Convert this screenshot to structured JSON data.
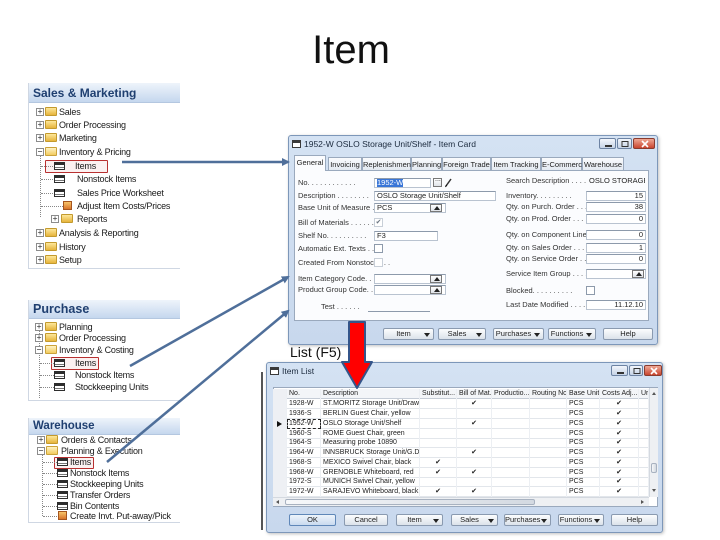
{
  "slide_title": "Item",
  "list_label": "List (F5)",
  "nav_panels": {
    "sales_marketing": {
      "header": "Sales & Marketing",
      "items": [
        {
          "label": "Sales",
          "expander": "+",
          "icon": "folder-icon"
        },
        {
          "label": "Order Processing",
          "expander": "+",
          "icon": "folder-icon"
        },
        {
          "label": "Marketing",
          "expander": "+",
          "icon": "folder-icon"
        },
        {
          "label": "Inventory & Pricing",
          "expander": "−",
          "icon": "folder-open-icon"
        },
        {
          "label": "Items",
          "icon": "list-icon",
          "highlighted": true
        },
        {
          "label": "Nonstock Items",
          "icon": "list-icon"
        },
        {
          "label": "Sales Price Worksheet",
          "icon": "list-icon"
        },
        {
          "label": "Adjust Item Costs/Prices",
          "icon": "task-icon"
        },
        {
          "label": "Reports",
          "expander": "+",
          "icon": "folder-icon"
        },
        {
          "label": "Analysis & Reporting",
          "expander": "+",
          "icon": "folder-icon"
        },
        {
          "label": "History",
          "expander": "+",
          "icon": "folder-icon"
        },
        {
          "label": "Setup",
          "expander": "+",
          "icon": "folder-icon"
        }
      ]
    },
    "purchase": {
      "header": "Purchase",
      "items": [
        {
          "label": "Planning",
          "expander": "+",
          "icon": "folder-icon"
        },
        {
          "label": "Order Processing",
          "expander": "+",
          "icon": "folder-icon"
        },
        {
          "label": "Inventory & Costing",
          "expander": "−",
          "icon": "folder-open-icon"
        },
        {
          "label": "Items",
          "icon": "list-icon",
          "highlighted": true
        },
        {
          "label": "Nonstock Items",
          "icon": "list-icon"
        },
        {
          "label": "Stockkeeping Units",
          "icon": "list-icon"
        }
      ]
    },
    "warehouse": {
      "header": "Warehouse",
      "items": [
        {
          "label": "Orders & Contacts",
          "expander": "+",
          "icon": "folder-icon"
        },
        {
          "label": "Planning & Execution",
          "expander": "−",
          "icon": "folder-open-icon"
        },
        {
          "label": "Items",
          "icon": "list-icon",
          "highlighted": true
        },
        {
          "label": "Nonstock Items",
          "icon": "list-icon"
        },
        {
          "label": "Stockkeeping Units",
          "icon": "list-icon"
        },
        {
          "label": "Transfer Orders",
          "icon": "list-icon"
        },
        {
          "label": "Bin Contents",
          "icon": "list-icon"
        },
        {
          "label": "Create Invt. Put-away/Pick",
          "icon": "task-icon"
        }
      ]
    }
  },
  "item_card": {
    "title": "1952-W OSLO Storage Unit/Shelf - Item Card",
    "tabs": [
      "General",
      "Invoicing",
      "Replenishment",
      "Planning",
      "Foreign Trade",
      "Item Tracking",
      "E-Commerce",
      "Warehouse"
    ],
    "active_tab": "General",
    "left_fields": [
      {
        "label": "No. . . . . . . . . . . .",
        "value": "1952-W"
      },
      {
        "label": "Description . . . . . . . .",
        "value": "OSLO Storage Unit/Shelf"
      },
      {
        "label": "Base Unit of Measure . . .",
        "value": "PCS"
      },
      {
        "label": "Bill of Materials . . . . . .",
        "value": "✔"
      },
      {
        "label": "Shelf No. . . . . . . . . .",
        "value": "F3"
      },
      {
        "label": "Automatic Ext. Texts . . .",
        "value": ""
      },
      {
        "label": "Created From Nonstock . . .",
        "value": ""
      },
      {
        "label": "Item Category Code. . .",
        "value": ""
      },
      {
        "label": "Product Group Code. . .",
        "value": ""
      },
      {
        "label": "Test . . . . . .",
        "value": ""
      }
    ],
    "right_fields": [
      {
        "label": "Search Description . . . .",
        "value": "OSLO STORAGE..."
      },
      {
        "label": "Inventory. . . . . . . . .",
        "value": "15"
      },
      {
        "label": "Qty. on Purch. Order . . .",
        "value": "38"
      },
      {
        "label": "Qty. on Prod. Order . . .",
        "value": "0"
      },
      {
        "label": "Qty. on Component Lines",
        "value": "0"
      },
      {
        "label": "Qty. on Sales Order . . . .",
        "value": "1"
      },
      {
        "label": "Qty. on Service Order . . .",
        "value": "0"
      },
      {
        "label": "Service Item Group . . . .",
        "value": ""
      },
      {
        "label": "Blocked. . . . . . . . . .",
        "value": ""
      },
      {
        "label": "Last Date Modified . . . .",
        "value": "11.12.10"
      }
    ],
    "buttons": {
      "item": "Item",
      "sales": "Sales",
      "purchases": "Purchases",
      "functions": "Functions",
      "help": "Help"
    }
  },
  "item_list": {
    "title": "Item List",
    "columns": [
      "No.",
      "Description",
      "Substitut...",
      "Bill of Mat...",
      "Productio...",
      "Routing No.",
      "Base Unit...",
      "Costs Adj...",
      "Ur"
    ],
    "selected_row": "1952-W",
    "rows": [
      {
        "no": "1928-W",
        "description": "ST.MORITZ Storage Unit/Drawers",
        "substitutes": "",
        "bill_of_materials": "✔",
        "production_bom": "",
        "routing_no": "",
        "base_unit": "PCS",
        "costs_adjusted": "✔"
      },
      {
        "no": "1936-S",
        "description": "BERLIN Guest Chair, yellow",
        "substitutes": "",
        "bill_of_materials": "",
        "production_bom": "",
        "routing_no": "",
        "base_unit": "PCS",
        "costs_adjusted": "✔"
      },
      {
        "no": "1952-W",
        "description": "OSLO Storage Unit/Shelf",
        "substitutes": "",
        "bill_of_materials": "✔",
        "production_bom": "",
        "routing_no": "",
        "base_unit": "PCS",
        "costs_adjusted": "✔"
      },
      {
        "no": "1960-S",
        "description": "ROME Guest Chair, green",
        "substitutes": "",
        "bill_of_materials": "",
        "production_bom": "",
        "routing_no": "",
        "base_unit": "PCS",
        "costs_adjusted": "✔"
      },
      {
        "no": "1964-S",
        "description": "Measuring probe 10890",
        "substitutes": "",
        "bill_of_materials": "",
        "production_bom": "",
        "routing_no": "",
        "base_unit": "PCS",
        "costs_adjusted": "✔"
      },
      {
        "no": "1964-W",
        "description": "INNSBRUCK Storage Unit/G.Door",
        "substitutes": "",
        "bill_of_materials": "✔",
        "production_bom": "",
        "routing_no": "",
        "base_unit": "PCS",
        "costs_adjusted": "✔"
      },
      {
        "no": "1968-S",
        "description": "MEXICO Swivel Chair, black",
        "substitutes": "✔",
        "bill_of_materials": "",
        "production_bom": "",
        "routing_no": "",
        "base_unit": "PCS",
        "costs_adjusted": "✔"
      },
      {
        "no": "1968-W",
        "description": "GRENOBLE Whiteboard, red",
        "substitutes": "✔",
        "bill_of_materials": "✔",
        "production_bom": "",
        "routing_no": "",
        "base_unit": "PCS",
        "costs_adjusted": "✔"
      },
      {
        "no": "1972-S",
        "description": "MUNICH Swivel Chair, yellow",
        "substitutes": "",
        "bill_of_materials": "",
        "production_bom": "",
        "routing_no": "",
        "base_unit": "PCS",
        "costs_adjusted": "✔"
      },
      {
        "no": "1972-W",
        "description": "SARAJEVO Whiteboard, black",
        "substitutes": "✔",
        "bill_of_materials": "✔",
        "production_bom": "",
        "routing_no": "",
        "base_unit": "PCS",
        "costs_adjusted": "✔"
      }
    ],
    "buttons": {
      "ok": "OK",
      "cancel": "Cancel",
      "item": "Item",
      "sales": "Sales",
      "purchases": "Purchases",
      "functions": "Functions",
      "help": "Help"
    }
  },
  "colors": {
    "arrow": "#4f6f9a",
    "highlight_box": "#b83030",
    "red_arrow": "#ff0000",
    "panel_header_text": "#1f3f70"
  }
}
